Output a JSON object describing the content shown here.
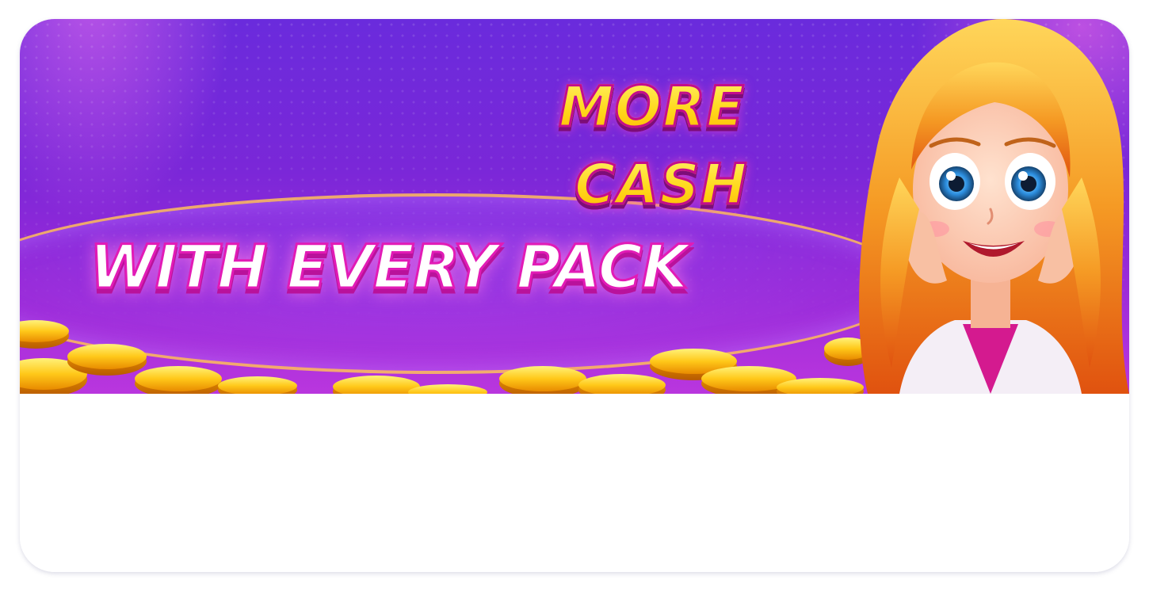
{
  "banner": {
    "headline_line1": "MORE",
    "headline_line2": "CASH",
    "tagline": "WITH EVERY PACK"
  },
  "colors": {
    "background_purple": "#7a27d8",
    "headline_yellow": "#ffd81b",
    "outline_magenta": "#e21bb6",
    "coin_gold": "#ffc21a",
    "hair_orange": "#f08a1c"
  },
  "icons": {
    "coins": "gold-coins-pile",
    "character": "cartoon-girl-character"
  }
}
